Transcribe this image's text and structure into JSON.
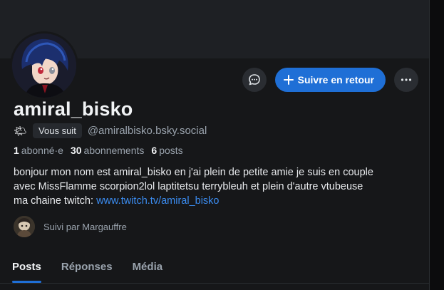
{
  "profile": {
    "display_name": "amiral_bisko",
    "follows_you_badge": "Vous suit",
    "handle": "@amiralbisko.bsky.social",
    "status_emoji": "🌤"
  },
  "actions": {
    "message_icon": "chat-bubble-icon",
    "follow_back_label": "Suivre en retour",
    "more_icon": "ellipsis-icon"
  },
  "stats": {
    "followers_count": "1",
    "followers_label": "abonné·e",
    "following_count": "30",
    "following_label": "abonnements",
    "posts_count": "6",
    "posts_label": "posts"
  },
  "bio": {
    "line1": "bonjour mon nom est amiral_bisko en j'ai plein de petite amie je suis en couple",
    "line2": "avec MissFlamme scorpion2lol laptitetsu terrybleuh et plein d'autre vtubeuse",
    "line3_prefix": "ma chaine twitch: ",
    "link_text": "www.twitch.tv/amiral_bisko"
  },
  "followed_by": {
    "text": "Suivi par Margauffre"
  },
  "tabs": [
    {
      "label": "Posts",
      "active": true
    },
    {
      "label": "Réponses",
      "active": false
    },
    {
      "label": "Média",
      "active": false
    }
  ],
  "colors": {
    "accent": "#1f6fd6",
    "link": "#3b8cf0",
    "background": "#161719"
  }
}
